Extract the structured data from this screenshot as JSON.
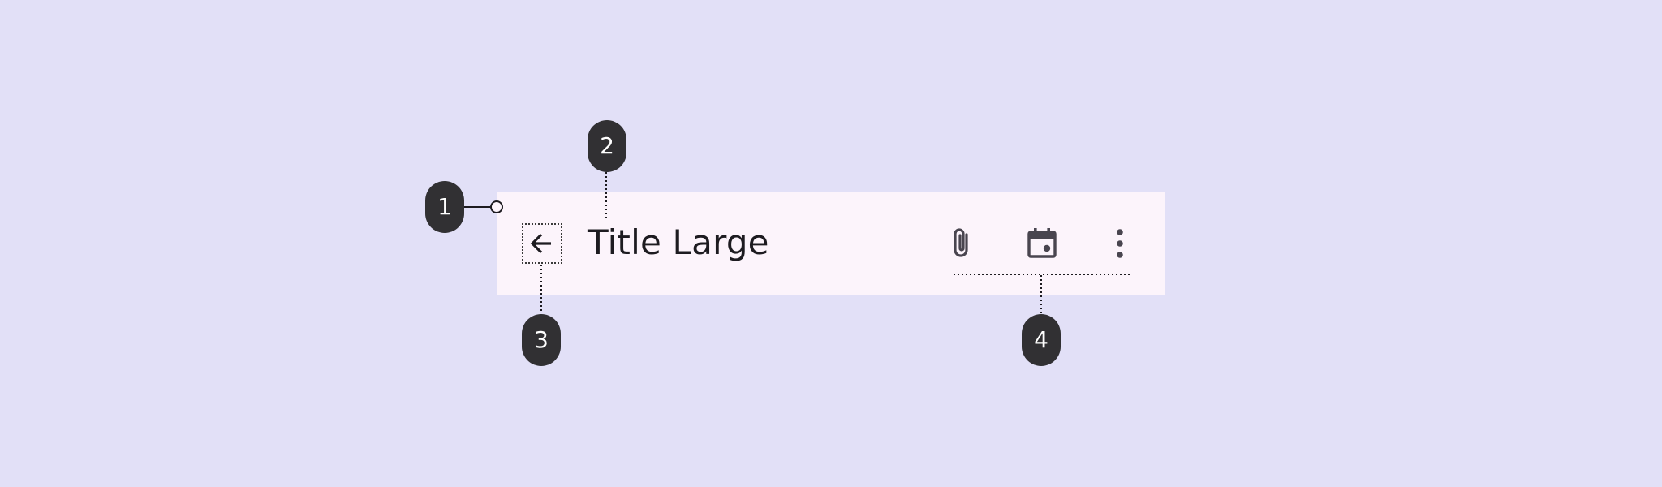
{
  "colors": {
    "background": "#e2e0f7",
    "app_bar_surface": "#fcf4fb",
    "badge_fill": "#313033",
    "badge_text": "#ffffff",
    "icon": "#49454f",
    "title_text": "#1d1b20"
  },
  "app_bar": {
    "title": "Title Large",
    "navigation_icon": "arrow-back-icon",
    "actions": [
      {
        "icon": "attach-file-icon"
      },
      {
        "icon": "calendar-event-icon"
      },
      {
        "icon": "more-vert-icon"
      }
    ]
  },
  "callouts": [
    {
      "number": "1"
    },
    {
      "number": "2"
    },
    {
      "number": "3"
    },
    {
      "number": "4"
    }
  ]
}
